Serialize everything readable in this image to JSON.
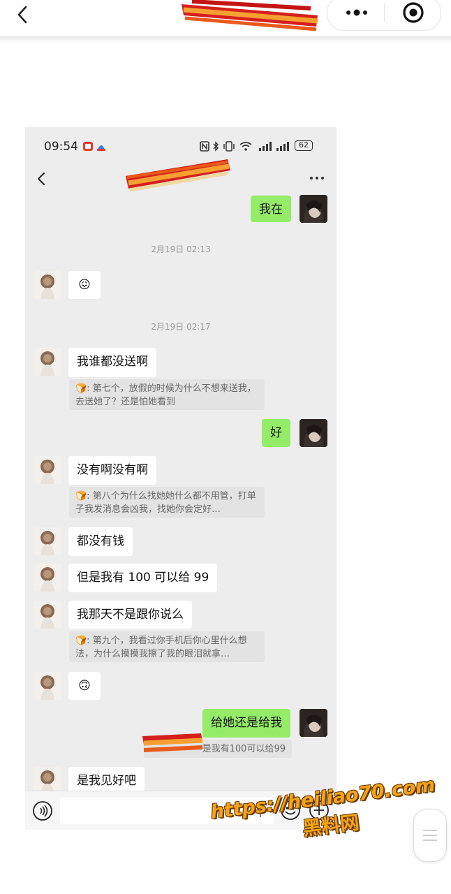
{
  "screenshot": {
    "status": {
      "time": "09:54",
      "battery": "62"
    },
    "timestamps": [
      "2月19日 02:13",
      "2月19日 02:17"
    ],
    "messages": {
      "m1": "我在",
      "m2": "😖",
      "m3": "我谁都没送啊",
      "m3_quote": "🍞: 第七个，放假的时候为什么不想来送我，去送她了？还是怕她看到",
      "m4": "好",
      "m5": "没有啊没有啊",
      "m5_quote": "🍞: 第八个为什么找她她什么都不用管，打单子我发消息会凶我，找她你会定好…",
      "m6": "都没有钱",
      "m7": "但是我有 100 可以给 99",
      "m8": "我那天不是跟你说么",
      "m8_quote": "🍞: 第九个，我看过你手机后你心里什么想法，为什么摸摸我擦了我的眼泪就拿…",
      "m9": "🙃",
      "m10": "给她还是给我",
      "m10_quote": "是我有100可以给99",
      "m11": "是我见好吧"
    }
  },
  "watermark": {
    "url": "https://heiliao70.com",
    "name": "黑料网"
  },
  "colors": {
    "sent_bubble": "#95ec69",
    "received_bubble": "#ffffff",
    "chat_bg": "#ededed"
  }
}
